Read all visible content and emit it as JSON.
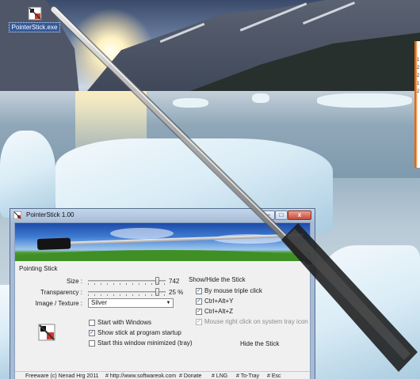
{
  "desktop": {
    "icon_label": "PointerStick.exe"
  },
  "window": {
    "title": "PointerStick 1.00",
    "controls": {
      "minimize": "–",
      "maximize": "□",
      "close": "x"
    }
  },
  "pointing_stick": {
    "group_label": "Pointing Stick",
    "size_label": "Size :",
    "size_value": "742",
    "transparency_label": "Transparency :",
    "transparency_value": "25 %",
    "image_label": "Image / Texture :",
    "image_value": "Silver",
    "size_level": 0.9,
    "transparency_level": 0.9
  },
  "show_hide": {
    "group_label": "Show/Hide the Stick",
    "options": [
      {
        "label": "By mouse triple click",
        "checked": true,
        "enabled": true
      },
      {
        "label": "Ctrl+Alt+Y",
        "checked": true,
        "enabled": true
      },
      {
        "label": "Ctrl+Alt+Z",
        "checked": true,
        "enabled": true
      },
      {
        "label": "Mouse right click on system tray icon",
        "checked": true,
        "enabled": false
      }
    ],
    "hide_button": "Hide the Stick"
  },
  "startup": {
    "options": [
      {
        "label": "Start with Windows",
        "checked": false
      },
      {
        "label": "Show stick at program startup",
        "checked": true
      },
      {
        "label": "Start this window minimized (tray)",
        "checked": false
      }
    ]
  },
  "statusbar": {
    "freeware": "Freeware (c) Nenad Hrg 2011",
    "url": "# http://www.softwareok.com",
    "donate": "# Donate",
    "lng": "# LNG",
    "to_tray": "# To-Tray",
    "esc": "# Esc"
  },
  "other_window_lines": [
    "1",
    "2",
    "2",
    "1",
    "2"
  ],
  "icons": {
    "app": "pointerstick-icon",
    "checkmark": "✓",
    "caret": "▼"
  },
  "colors": {
    "titlebar": "#a7bed9",
    "close_button": "#c6493a",
    "desktop_icon_highlight": "#355a9a",
    "tray_accent": "#f07b1c"
  }
}
